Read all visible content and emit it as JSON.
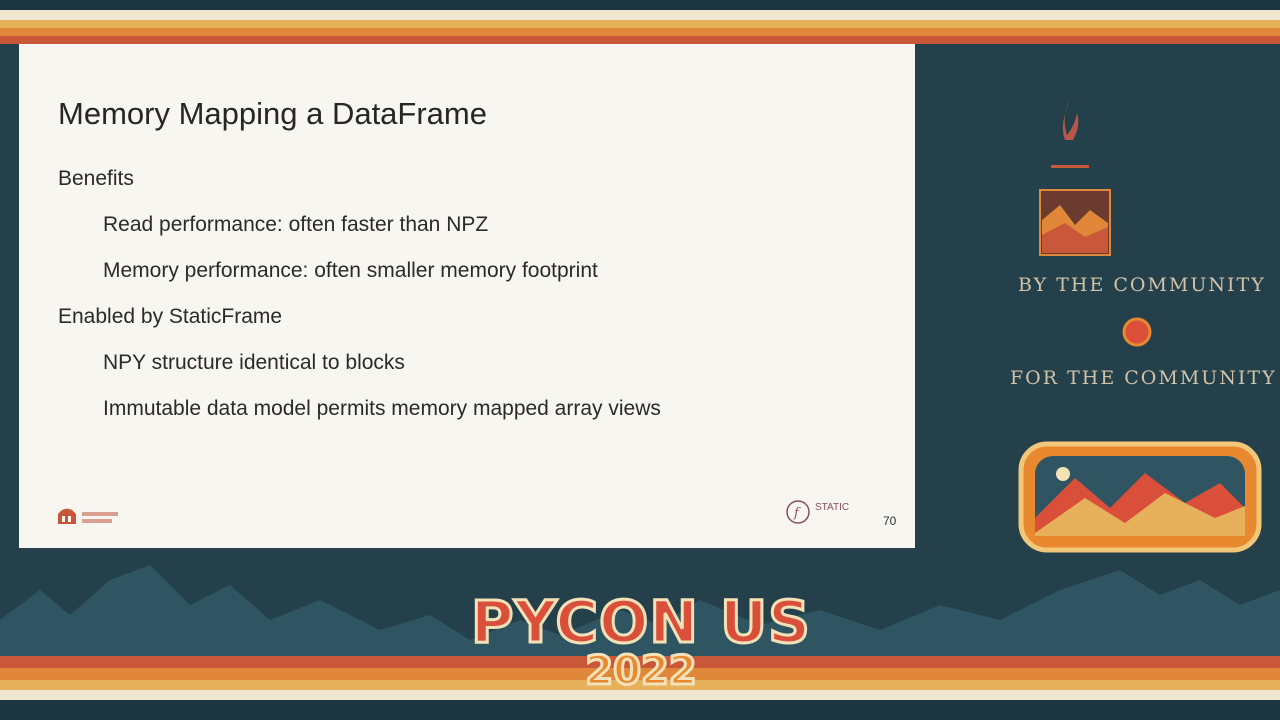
{
  "slide": {
    "title": "Memory Mapping a DataFrame",
    "bullets": [
      {
        "text": "Benefits"
      },
      {
        "text": "Read performance: often faster than NPZ"
      },
      {
        "text": "Memory performance: often smaller memory footprint"
      },
      {
        "text": "Enabled by StaticFrame"
      },
      {
        "text": "NPY structure identical to blocks"
      },
      {
        "text": "Immutable data model permits memory mapped array views"
      }
    ],
    "page_number": "70",
    "logo_right_text": "STATIC"
  },
  "side_panel": {
    "line1": "BY THE COMMUNITY",
    "line2": "FOR THE COMMUNITY"
  },
  "banner": {
    "title": "PYCON US",
    "year": "2022"
  },
  "colors": {
    "background": "#23404b",
    "slide_bg": "#f7f6f0",
    "accent_red": "#d94f3a",
    "accent_orange": "#e8892f"
  }
}
